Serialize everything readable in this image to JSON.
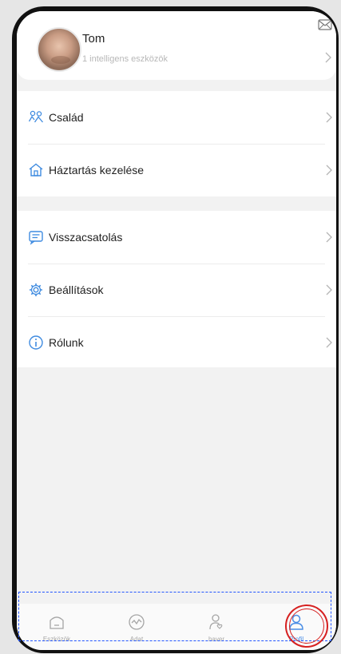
{
  "profile": {
    "name": "Tom",
    "subtitle": "1 intelligens eszközök",
    "mail_icon": "mail-icon",
    "avatar": "user-avatar"
  },
  "menu_group_1": [
    {
      "label": "Család",
      "icon": "family-icon"
    },
    {
      "label": "Háztartás kezelése",
      "icon": "home-icon"
    }
  ],
  "menu_group_2": [
    {
      "label": "Visszacsatolás",
      "icon": "feedback-icon"
    },
    {
      "label": "Beállítások",
      "icon": "settings-icon"
    },
    {
      "label": "Rólunk",
      "icon": "info-icon"
    }
  ],
  "tabbar": {
    "tabs": [
      {
        "label": "Eszközök",
        "icon": "devices-icon",
        "active": false
      },
      {
        "label": "Adat",
        "icon": "data-icon",
        "active": false
      },
      {
        "label": "haver",
        "icon": "friend-icon",
        "active": false
      },
      {
        "label": "Profil",
        "icon": "profile-icon",
        "active": true
      }
    ]
  },
  "colors": {
    "accent": "#4b8ee6",
    "background": "#f2f2f2",
    "annotation_box": "#2255ff",
    "annotation_circle": "#d62020"
  }
}
